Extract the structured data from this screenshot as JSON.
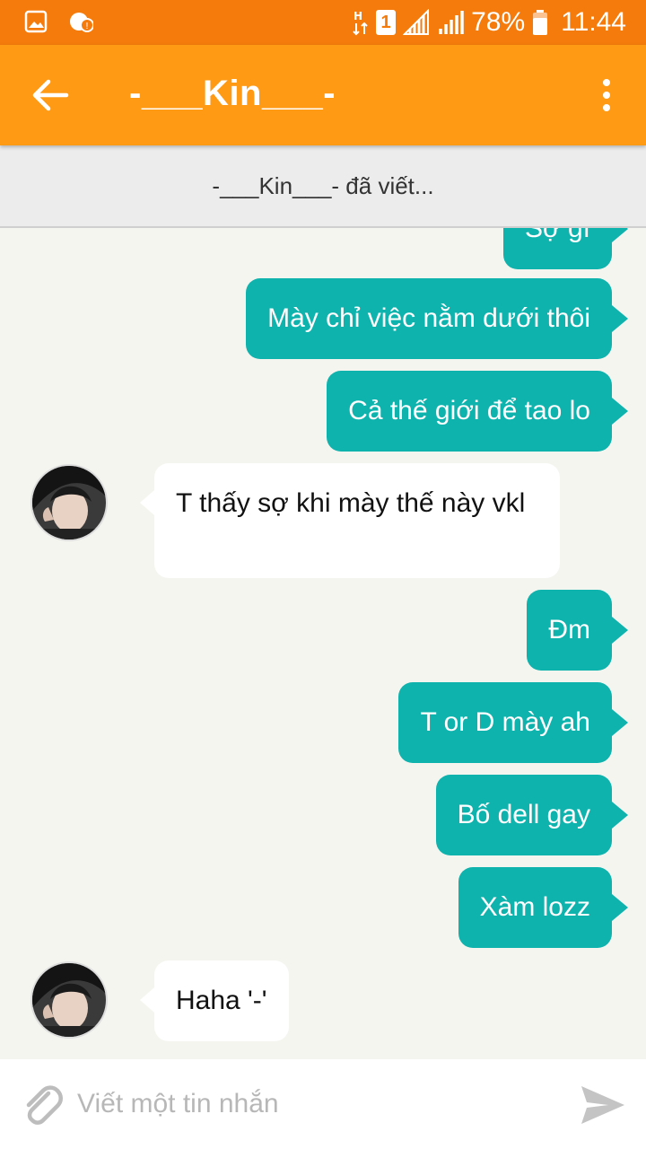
{
  "status_bar": {
    "sim_indicator": "1",
    "battery": "78%",
    "time": "11:44"
  },
  "header": {
    "title": "-___Kin___-"
  },
  "typing_status": "-___Kin___- đã viết...",
  "messages": [
    {
      "direction": "out",
      "text": "Sợ gì"
    },
    {
      "direction": "out",
      "text": "Mày chỉ việc nằm dưới thôi"
    },
    {
      "direction": "out",
      "text": "Cả thế giới để tao lo"
    },
    {
      "direction": "in",
      "text": "T thấy sợ khi mày thế này vkl"
    },
    {
      "direction": "out",
      "text": "Đm"
    },
    {
      "direction": "out",
      "text": "T or D mày ah"
    },
    {
      "direction": "out",
      "text": "Bố dell gay"
    },
    {
      "direction": "out",
      "text": "Xàm lozz"
    },
    {
      "direction": "in",
      "text": "Haha '-'"
    }
  ],
  "composer": {
    "placeholder": "Viết một tin nhắn"
  },
  "colors": {
    "status_bar": "#f47b0c",
    "app_bar": "#ff9a15",
    "outgoing_bubble": "#0fb3ae",
    "incoming_bubble": "#ffffff",
    "chat_background": "#f5f5f0"
  }
}
